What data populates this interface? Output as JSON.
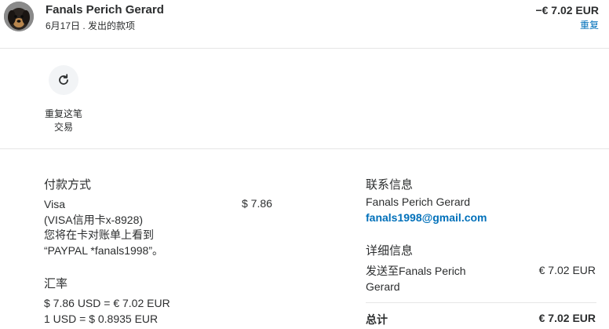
{
  "header": {
    "name": "Fanals Perich Gerard",
    "subtitle": "6月17日 . 发出的款项",
    "amount": "−€ 7.02 EUR",
    "repeat_link": "重复"
  },
  "actions": {
    "repeat_label_line1": "重复这笔",
    "repeat_label_line2": "交易",
    "icon": "refresh-icon"
  },
  "payment": {
    "title": "付款方式",
    "method": "Visa",
    "card": "(VISA信用卡x-8928)",
    "statement_note": "您将在卡对账单上看到",
    "statement_descriptor": "“PAYPAL *fanals1998”。",
    "amount": "$ 7.86"
  },
  "exchange": {
    "title": "汇率",
    "line1": "$ 7.86 USD = € 7.02 EUR",
    "line2": "1 USD = $ 0.8935 EUR"
  },
  "contact": {
    "title": "联系信息",
    "name": "Fanals Perich Gerard",
    "email": "fanals1998@gmail.com"
  },
  "details": {
    "title": "详细信息",
    "sent_to_line1": "发送至Fanals Perich",
    "sent_to_line2": "Gerard",
    "sent_amount": "€ 7.02 EUR",
    "total_label": "总计",
    "total_amount": "€ 7.02 EUR"
  }
}
